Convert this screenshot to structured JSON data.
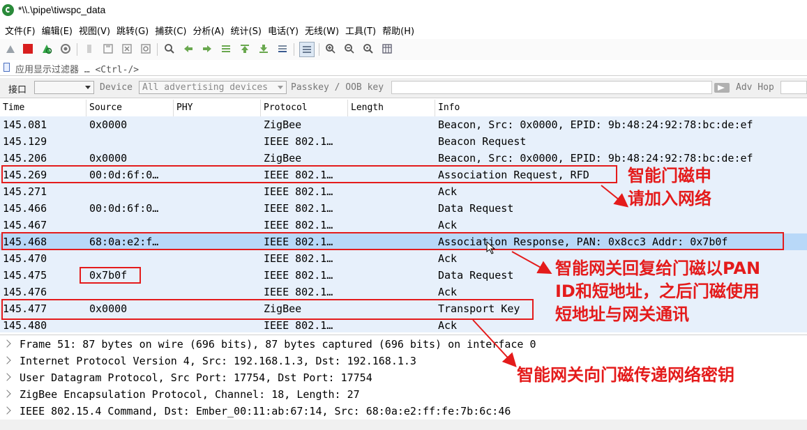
{
  "window": {
    "title": "*\\\\.\\pipe\\tiwspc_data"
  },
  "menu": [
    "文件(F)",
    "编辑(E)",
    "视图(V)",
    "跳转(G)",
    "捕获(C)",
    "分析(A)",
    "统计(S)",
    "电话(Y)",
    "无线(W)",
    "工具(T)",
    "帮助(H)"
  ],
  "filter": {
    "placeholder": "应用显示过滤器 … <Ctrl-/>"
  },
  "interface_bar": {
    "interface_label": "接口",
    "device_label": "Device",
    "device_value": "All advertising devices",
    "passkey_label": "Passkey / OOB key",
    "adv_hop_label": "Adv Hop"
  },
  "columns": [
    "Time",
    "Source",
    "PHY",
    "Protocol",
    "Length",
    "Info"
  ],
  "packets": [
    {
      "time": "145.081",
      "source": "0x0000",
      "protocol": "ZigBee",
      "info": "Beacon, Src: 0x0000, EPID: 9b:48:24:92:78:bc:de:ef"
    },
    {
      "time": "145.129",
      "source": "",
      "protocol": "IEEE 802.1…",
      "info": "Beacon Request"
    },
    {
      "time": "145.206",
      "source": "0x0000",
      "protocol": "ZigBee",
      "info": "Beacon, Src: 0x0000, EPID: 9b:48:24:92:78:bc:de:ef"
    },
    {
      "time": "145.269",
      "source": "00:0d:6f:0…",
      "protocol": "IEEE 802.1…",
      "info": "Association Request, RFD"
    },
    {
      "time": "145.271",
      "source": "",
      "protocol": "IEEE 802.1…",
      "info": "Ack"
    },
    {
      "time": "145.466",
      "source": "00:0d:6f:0…",
      "protocol": "IEEE 802.1…",
      "info": "Data Request"
    },
    {
      "time": "145.467",
      "source": "",
      "protocol": "IEEE 802.1…",
      "info": "Ack"
    },
    {
      "time": "145.468",
      "source": "68:0a:e2:f…",
      "protocol": "IEEE 802.1…",
      "info": "Association Response, PAN: 0x8cc3 Addr: 0x7b0f",
      "selected": true
    },
    {
      "time": "145.470",
      "source": "",
      "protocol": "IEEE 802.1…",
      "info": "Ack"
    },
    {
      "time": "145.475",
      "source": "0x7b0f",
      "protocol": "IEEE 802.1…",
      "info": "Data Request"
    },
    {
      "time": "145.476",
      "source": "",
      "protocol": "IEEE 802.1…",
      "info": "Ack"
    },
    {
      "time": "145.477",
      "source": "0x0000",
      "protocol": "ZigBee",
      "info": "Transport Key"
    },
    {
      "time": "145.480",
      "source": "",
      "protocol": "IEEE 802.1…",
      "info": "Ack"
    }
  ],
  "details": [
    "Frame 51: 87 bytes on wire (696 bits), 87 bytes captured (696 bits) on interface 0",
    "Internet Protocol Version 4, Src: 192.168.1.3, Dst: 192.168.1.3",
    "User Datagram Protocol, Src Port: 17754, Dst Port: 17754",
    "ZigBee Encapsulation Protocol, Channel: 18, Length: 27",
    "IEEE 802.15.4 Command, Dst: Ember_00:11:ab:67:14, Src: 68:0a:e2:ff:fe:7b:6c:46"
  ],
  "annotations": {
    "a1": [
      "智能门磁申",
      "请加入网络"
    ],
    "a2": [
      "智能网关回复给门磁以PAN",
      "ID和短地址，之后门磁使用",
      "短地址与网关通讯"
    ],
    "a3": [
      "智能网关向门磁传递网络密钥"
    ]
  },
  "colors": {
    "annotation": "#e41b1b",
    "row": "#e7f0fb",
    "selected": "#b8d8f8"
  },
  "toolbar_icons": [
    "shark-fin-icon",
    "stop-icon",
    "restart-icon",
    "options-icon",
    "open-icon",
    "save-icon",
    "close-file-icon",
    "reload-icon",
    "find-icon",
    "back-icon",
    "forward-icon",
    "goto-icon",
    "first-icon",
    "last-icon",
    "autoscroll-icon",
    "colorize-icon",
    "zoom-in-icon",
    "zoom-out-icon",
    "zoom-reset-icon",
    "resize-columns-icon"
  ]
}
